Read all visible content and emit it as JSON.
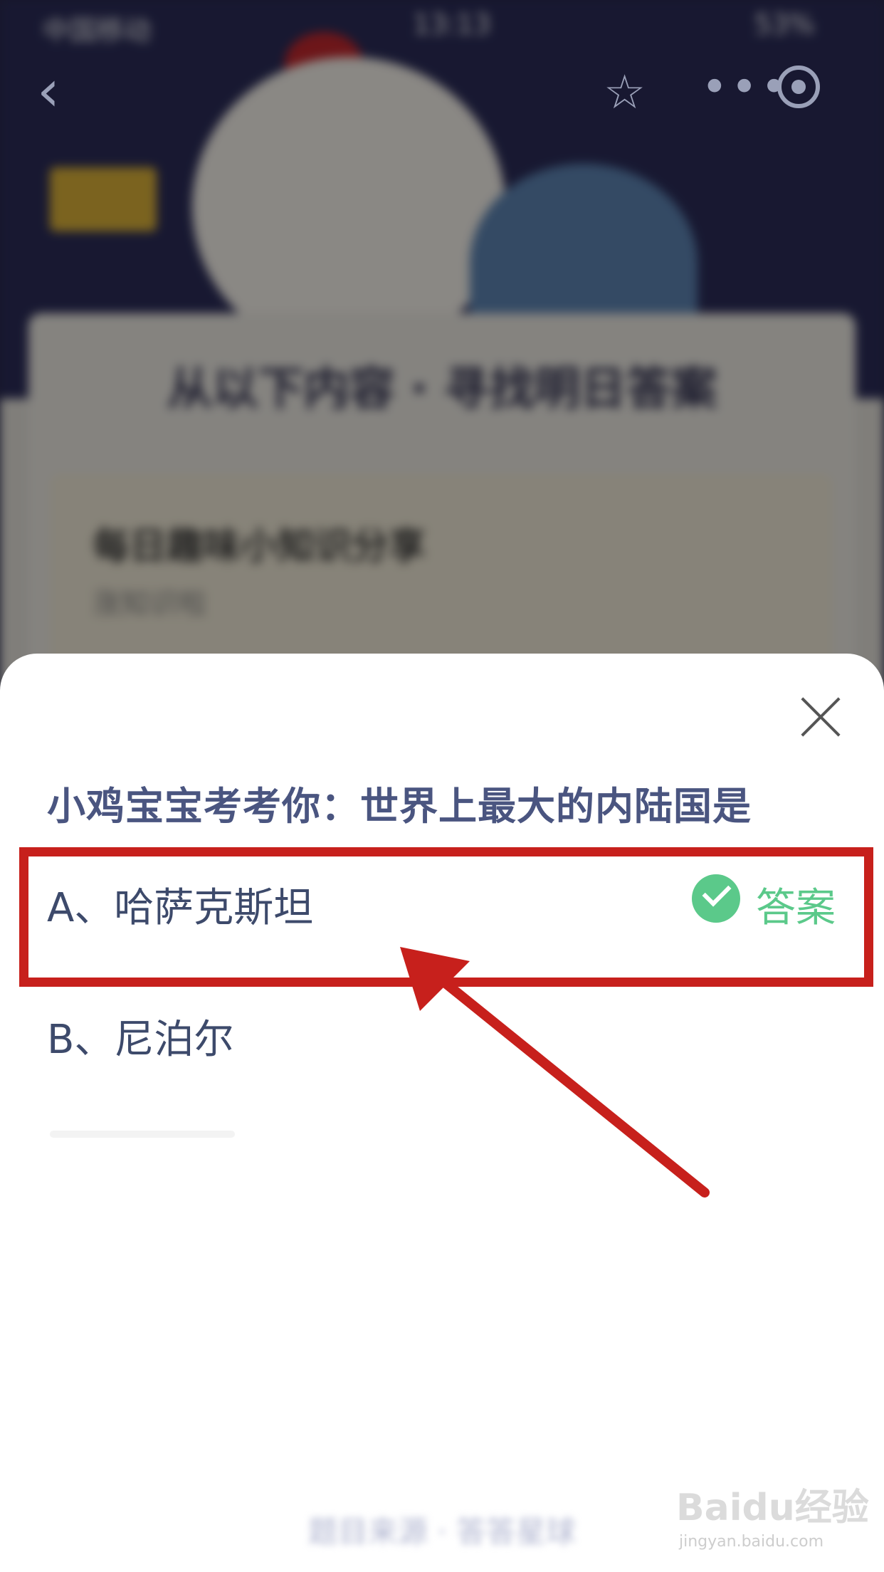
{
  "status_bar": {
    "carrier": "中国移动",
    "time": "13:13",
    "battery": "53%"
  },
  "background": {
    "panel_title": "从以下内容 · 寻找明日答案",
    "card_title": "每日趣味小知识分享",
    "card_subtitle": "涨知识啦"
  },
  "sheet": {
    "question": "小鸡宝宝考考你：世界上最大的内陆国是",
    "options": [
      {
        "label": "A、哈萨克斯坦",
        "is_answer": true
      },
      {
        "label": "B、尼泊尔",
        "is_answer": false
      }
    ],
    "answer_label": "答案",
    "footer_text": "题目来源 · 答答星球"
  },
  "icons": {
    "back": "chevron-left-icon",
    "star": "star-icon",
    "more": "more-icon",
    "target": "target-icon",
    "close": "close-icon",
    "check": "check-circle-icon"
  },
  "watermark": {
    "logo": "Baidu经验",
    "url": "jingyan.baidu.com"
  },
  "colors": {
    "answer_green": "#5bc98a",
    "question_text": "#4a5580",
    "annotation_red": "#c7201c"
  }
}
